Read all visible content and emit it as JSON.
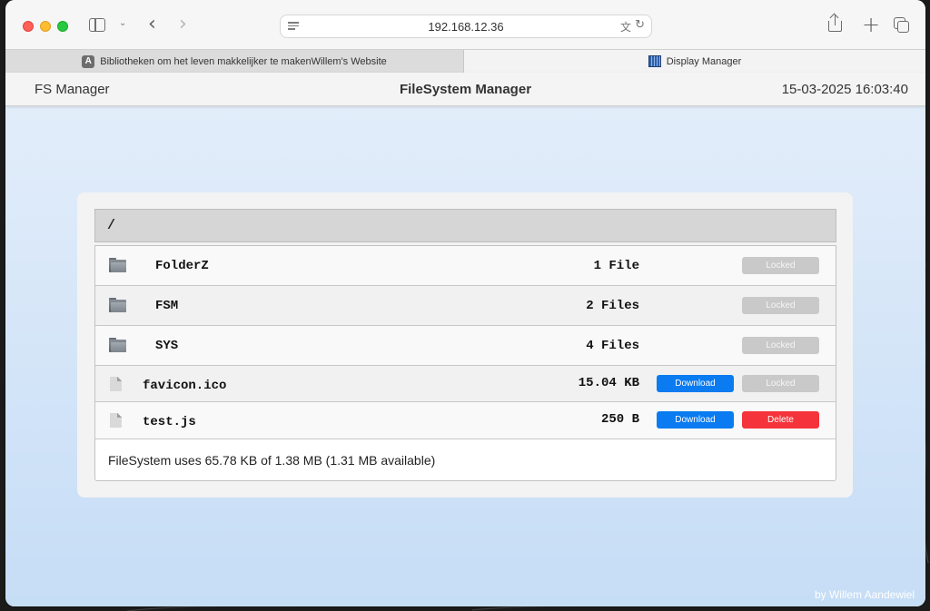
{
  "browser": {
    "url": "192.168.12.36",
    "tabs": [
      {
        "label": "Bibliotheken om het leven makkelijker te makenWillem's Website",
        "favicon_letter": "A",
        "active": false
      },
      {
        "label": "Display Manager",
        "active": true
      }
    ]
  },
  "app": {
    "brand": "FS Manager",
    "title": "FileSystem Manager",
    "datetime": "15-03-2025 16:03:40"
  },
  "filesystem": {
    "path": "/",
    "entries": [
      {
        "type": "folder",
        "name": "FolderZ",
        "size": "1 File",
        "action": "Locked"
      },
      {
        "type": "folder",
        "name": "FSM",
        "size": "2 Files",
        "action": "Locked"
      },
      {
        "type": "folder",
        "name": "SYS",
        "size": "4 Files",
        "action": "Locked"
      },
      {
        "type": "file",
        "name": "favicon.ico",
        "size": "15.04 KB",
        "download": "Download",
        "action": "Locked"
      },
      {
        "type": "file",
        "name": "test.js",
        "size": "250 B",
        "download": "Download",
        "action": "Delete"
      }
    ],
    "usage": "FileSystem uses 65.78 KB of 1.38 MB (1.31 MB available)"
  },
  "byline": "by Willem Aandewiel",
  "colors": {
    "download": "#0a7bf0",
    "delete": "#f4343a",
    "locked": "#c9c9c9"
  }
}
